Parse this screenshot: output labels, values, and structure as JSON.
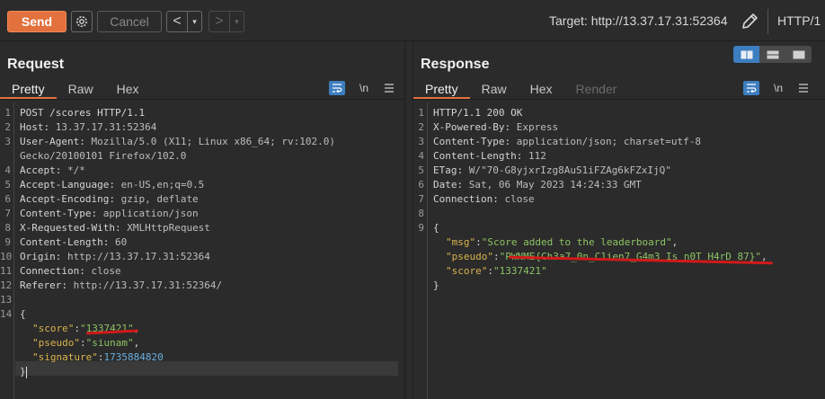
{
  "toolbar": {
    "send_label": "Send",
    "cancel_label": "Cancel",
    "back_arrow": "<",
    "forward_arrow": ">",
    "dropdown_glyph": "▾",
    "target_text": "Target: http://13.37.17.31:52364",
    "protocol": "HTTP/1"
  },
  "request": {
    "title": "Request",
    "tabs": [
      "Pretty",
      "Raw",
      "Hex"
    ],
    "newline_toggle": "\\n",
    "lines": [
      {
        "n": "1",
        "k": "POST /scores HTTP/1.1",
        "v": ""
      },
      {
        "n": "2",
        "k": "Host:",
        "v": " 13.37.17.31:52364"
      },
      {
        "n": "3",
        "k": "User-Agent:",
        "v": " Mozilla/5.0 (X11; Linux x86_64; rv:102.0)"
      },
      {
        "n": "",
        "k": "",
        "v": "Gecko/20100101 Firefox/102.0"
      },
      {
        "n": "4",
        "k": "Accept:",
        "v": " */*"
      },
      {
        "n": "5",
        "k": "Accept-Language:",
        "v": " en-US,en;q=0.5"
      },
      {
        "n": "6",
        "k": "Accept-Encoding:",
        "v": " gzip, deflate"
      },
      {
        "n": "7",
        "k": "Content-Type:",
        "v": " application/json"
      },
      {
        "n": "8",
        "k": "X-Requested-With:",
        "v": " XMLHttpRequest"
      },
      {
        "n": "9",
        "k": "Content-Length:",
        "v": " 60"
      },
      {
        "n": "10",
        "k": "Origin:",
        "v": " http://13.37.17.31:52364"
      },
      {
        "n": "11",
        "k": "Connection:",
        "v": " close"
      },
      {
        "n": "12",
        "k": "Referer:",
        "v": " http://13.37.17.31:52364/"
      },
      {
        "n": "13",
        "k": "",
        "v": ""
      },
      {
        "n": "14",
        "k": "{",
        "v": ""
      }
    ],
    "body": [
      {
        "key": "\"score\"",
        "val": "\"1337421\"",
        "type": "s",
        "tail": ","
      },
      {
        "key": "\"pseudo\"",
        "val": "\"siunam\"",
        "type": "s",
        "tail": ","
      },
      {
        "key": "\"signature\"",
        "val": "1735884820",
        "type": "n",
        "tail": ""
      }
    ],
    "close": "}"
  },
  "response": {
    "title": "Response",
    "tabs": [
      "Pretty",
      "Raw",
      "Hex",
      "Render"
    ],
    "newline_toggle": "\\n",
    "lines": [
      {
        "n": "1",
        "k": "HTTP/1.1 200 OK",
        "v": ""
      },
      {
        "n": "2",
        "k": "X-Powered-By:",
        "v": " Express"
      },
      {
        "n": "3",
        "k": "Content-Type:",
        "v": " application/json; charset=utf-8"
      },
      {
        "n": "4",
        "k": "Content-Length:",
        "v": " 112"
      },
      {
        "n": "5",
        "k": "ETag:",
        "v": " W/\"70-G8yjxrIzg8AuS1iFZAg6kFZxIjQ\""
      },
      {
        "n": "6",
        "k": "Date:",
        "v": " Sat, 06 May 2023 14:24:33 GMT"
      },
      {
        "n": "7",
        "k": "Connection:",
        "v": " close"
      },
      {
        "n": "8",
        "k": "",
        "v": ""
      },
      {
        "n": "9",
        "k": "{",
        "v": ""
      }
    ],
    "body": [
      {
        "key": "\"msg\"",
        "val": "\"Score added to the leaderboard\"",
        "type": "s",
        "tail": ","
      },
      {
        "key": "\"pseudo\"",
        "val": "\"PWNME{Ch3a7_0n_C1ien7_G4m3_Is_n0T_H4rD_87}\"",
        "type": "s",
        "tail": ","
      },
      {
        "key": "\"score\"",
        "val": "\"1337421\"",
        "type": "s",
        "tail": ""
      }
    ],
    "close": "}"
  },
  "colors": {
    "send": "#e2713e",
    "accent_blue": "#3d7ec0",
    "json_key": "#d9b34d",
    "json_string": "#8dc264",
    "json_number": "#6ab0de",
    "annotation_red": "#d11a1a"
  }
}
